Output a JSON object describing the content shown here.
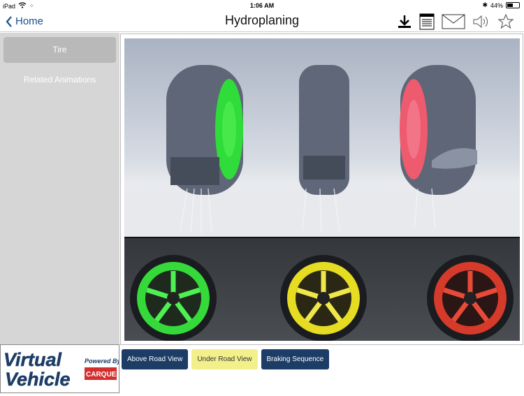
{
  "status": {
    "device": "iPad",
    "time": "1:06 AM",
    "battery": "44%"
  },
  "nav": {
    "back_label": "Home",
    "title": "Hydroplaning"
  },
  "toolbar": {
    "icons": [
      "download-icon",
      "notes-icon",
      "mail-icon",
      "speaker-icon",
      "star-icon"
    ]
  },
  "sidebar": {
    "tire_label": "Tire",
    "related_label": "Related Animations"
  },
  "logo": {
    "brand_top": "Virtual",
    "brand_bottom": "Vehicle",
    "powered_by": "Powered By",
    "partner": "CARQUEST"
  },
  "views": [
    {
      "label": "Above Road View"
    },
    {
      "label": "Under Road View"
    },
    {
      "label": "Braking Sequence"
    }
  ],
  "colors": {
    "accent": "#1c3d66",
    "selected": "#f3f08c",
    "green": "#3dd13a",
    "yellow": "#e8e020",
    "red": "#e0302a"
  }
}
